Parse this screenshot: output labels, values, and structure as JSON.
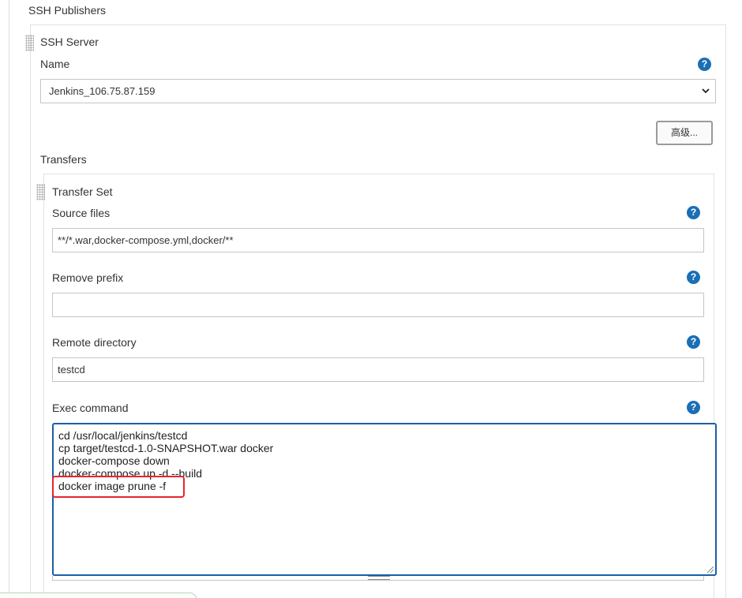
{
  "ssh_publishers": {
    "title": "SSH Publishers",
    "server": {
      "heading": "SSH Server",
      "name_label": "Name",
      "name_value": "Jenkins_106.75.87.159",
      "advanced_button": "高级...",
      "transfers_label": "Transfers",
      "transfer_set": {
        "heading": "Transfer Set",
        "source_files_label": "Source files",
        "source_files_value": "**/*.war,docker-compose.yml,docker/**",
        "remove_prefix_label": "Remove prefix",
        "remove_prefix_value": "",
        "remote_directory_label": "Remote directory",
        "remote_directory_value": "testcd",
        "exec_command_label": "Exec command",
        "exec_command_lines": [
          "cd /usr/local/jenkins/testcd",
          "cp target/testcd-1.0-SNAPSHOT.war docker",
          "docker-compose down",
          "docker-compose up -d --build",
          "docker image prune -f"
        ]
      }
    }
  },
  "help_icon_glyph": "?",
  "colors": {
    "help_icon": "#1a6fb5",
    "textarea_focus_border": "#1d5ea8",
    "highlight_box": "#e8262b"
  }
}
